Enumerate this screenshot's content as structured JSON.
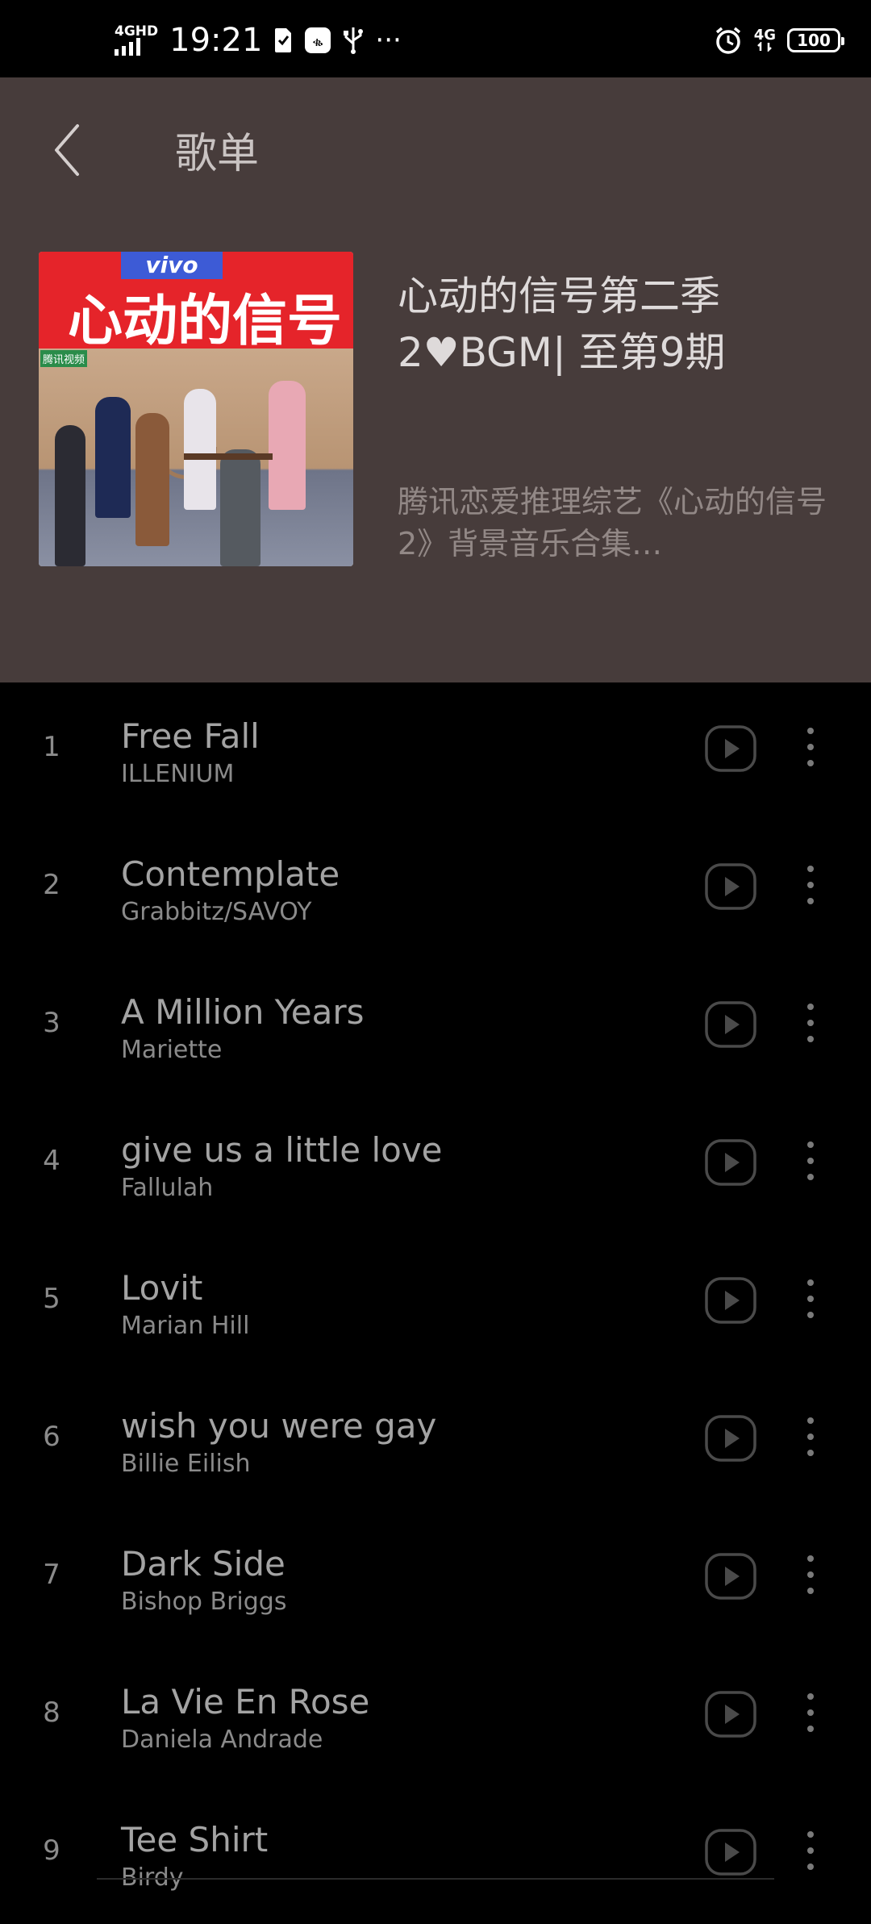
{
  "status_bar": {
    "network": "4GHD",
    "time": "19:21",
    "overflow": "···",
    "network_right": "4G",
    "battery": "100"
  },
  "header": {
    "title": "歌单",
    "back_icon": "chevron-left-icon"
  },
  "playlist": {
    "cover_brand": "vivo",
    "cover_show": "心动的信号",
    "cover_tag": "腾讯视频",
    "title": "心动的信号第二季2♥BGM| 至第9期",
    "description": "腾讯恋爱推理综艺《心动的信号2》背景音乐合集…"
  },
  "tracks": [
    {
      "num": "1",
      "title": "Free Fall",
      "artist": "ILLENIUM"
    },
    {
      "num": "2",
      "title": "Contemplate",
      "artist": "Grabbitz/SAVOY"
    },
    {
      "num": "3",
      "title": "A Million Years",
      "artist": "Mariette"
    },
    {
      "num": "4",
      "title": "give us a little love",
      "artist": "Fallulah"
    },
    {
      "num": "5",
      "title": "Lovit",
      "artist": "Marian Hill"
    },
    {
      "num": "6",
      "title": "wish you were gay",
      "artist": "Billie Eilish"
    },
    {
      "num": "7",
      "title": "Dark Side",
      "artist": "Bishop Briggs"
    },
    {
      "num": "8",
      "title": "La Vie En Rose",
      "artist": "Daniela Andrade"
    },
    {
      "num": "9",
      "title": "Tee Shirt",
      "artist": "Birdy"
    }
  ],
  "colors": {
    "header_bg": "#473c3b",
    "list_bg": "#000000",
    "title_text": "#dedada",
    "description_text": "#928886"
  }
}
